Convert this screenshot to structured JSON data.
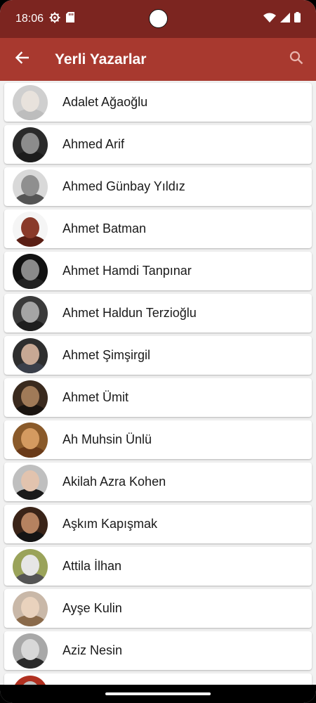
{
  "status": {
    "time": "18:06"
  },
  "app_bar": {
    "title": "Yerli Yazarlar",
    "back_icon": "arrow-left-icon",
    "search_icon": "search-icon"
  },
  "authors": [
    {
      "name": "Adalet Ağaoğlu",
      "bg": "#cfcfcf",
      "face": "#e8e2dc",
      "body": "#bdbdbd"
    },
    {
      "name": "Ahmed Arif",
      "bg": "#2a2a2a",
      "face": "#8c8c8c",
      "body": "#1c1c1c"
    },
    {
      "name": "Ahmed Günbay Yıldız",
      "bg": "#d9d9d9",
      "face": "#8f8f8f",
      "body": "#555555"
    },
    {
      "name": "Ahmet Batman",
      "bg": "#f5f5f5",
      "face": "#8a3a2a",
      "body": "#5a1e14"
    },
    {
      "name": "Ahmet Hamdi Tanpınar",
      "bg": "#111111",
      "face": "#8a8a8a",
      "body": "#222222"
    },
    {
      "name": "Ahmet Haldun Terzioğlu",
      "bg": "#3a3a3a",
      "face": "#a5a5a5",
      "body": "#1e1e1e"
    },
    {
      "name": "Ahmet Şimşirgil",
      "bg": "#2e2e2e",
      "face": "#c7a894",
      "body": "#3a3f4a"
    },
    {
      "name": "Ahmet Ümit",
      "bg": "#3a2a1e",
      "face": "#a07a58",
      "body": "#1a1410"
    },
    {
      "name": "Ah Muhsin Ünlü",
      "bg": "#8a5a2a",
      "face": "#d49a60",
      "body": "#6a3a18"
    },
    {
      "name": "Akilah Azra Kohen",
      "bg": "#bfbfbf",
      "face": "#e2c3ae",
      "body": "#1a1a1a"
    },
    {
      "name": "Aşkım Kapışmak",
      "bg": "#3a2418",
      "face": "#b58260",
      "body": "#141414"
    },
    {
      "name": "Attila İlhan",
      "bg": "#9aa35a",
      "face": "#e6e6e6",
      "body": "#555555"
    },
    {
      "name": "Ayşe Kulin",
      "bg": "#c9b8a8",
      "face": "#e9d2bd",
      "body": "#8a6a4a"
    },
    {
      "name": "Aziz Nesin",
      "bg": "#a8a8a8",
      "face": "#d8d8d8",
      "body": "#2a2a2a"
    },
    {
      "name": "",
      "bg": "#b03020",
      "face": "#c0c0c0",
      "body": "#333333"
    }
  ]
}
